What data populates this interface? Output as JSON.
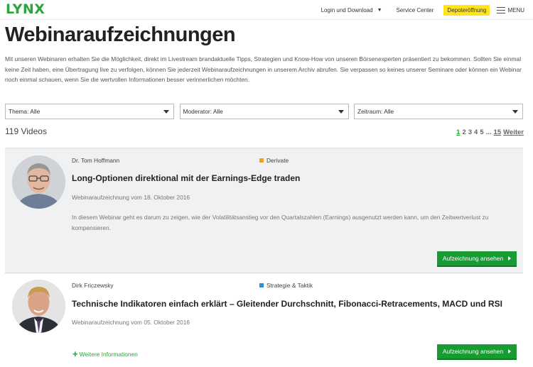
{
  "header": {
    "logo": "LYNX",
    "login_label": "Login und Download",
    "service_label": "Service Center",
    "depot_label": "Depoteröffnung",
    "menu_label": "MENU"
  },
  "page": {
    "title": "Webinaraufzeichnungen",
    "intro": "Mit unseren Webinaren erhalten Sie die Möglichkeit, direkt im Livestream brandaktuelle Tipps, Strategien und Know-How von unseren Börsenexperten präsentiert zu bekommen. Sollten Sie einmal keine Zeit haben, eine Übertragung live zu verfolgen, können Sie jederzeit Webinaraufzeichnungen in unserem Archiv abrufen. Sie verpassen so keines unserer Seminare oder können ein Webinar noch einmal schauen, wenn Sie die wertvollen Informationen besser verinnerlichen möchten."
  },
  "filters": {
    "thema": "Thema: Alle",
    "moderator": "Moderator: Alle",
    "zeitraum": "Zeitraum: Alle"
  },
  "results": {
    "count": "119 Videos"
  },
  "pagination": {
    "pages": [
      "1",
      "2",
      "3",
      "4",
      "5"
    ],
    "ellipsis": "...",
    "last": "15",
    "next": "Weiter"
  },
  "webinars": [
    {
      "author": "Dr. Tom Hoffmann",
      "category": "Derivate",
      "category_color": "#f0a020",
      "title": "Long-Optionen direktional mit der Earnings-Edge traden",
      "date": "Webinaraufzeichnung vom 18. Oktober 2016",
      "description": "In diesem Webinar geht es darum zu zeigen, wie der Volatilitätsanstieg vor den Quartalszahlen (Earnings) ausgenutzt werden kann, um den Zeitwertverlust zu kompensieren.",
      "button": "Aufzeichnung ansehen"
    },
    {
      "author": "Dirk Friczewsky",
      "category": "Strategie & Taktik",
      "category_color": "#2e8fd6",
      "title": "Technische Indikatoren einfach erklärt – Gleitender Durchschnitt, Fibonacci-Retracements, MACD und RSI",
      "date": "Webinaraufzeichnung vom 05. Oktober 2016",
      "more": "Weitere Informationen",
      "button": "Aufzeichnung ansehen"
    }
  ],
  "colors": {
    "brand_green": "#2aa63a",
    "button_green": "#189b33",
    "depot_yellow": "#ffe418",
    "card_bg": "#f0f1f3"
  }
}
